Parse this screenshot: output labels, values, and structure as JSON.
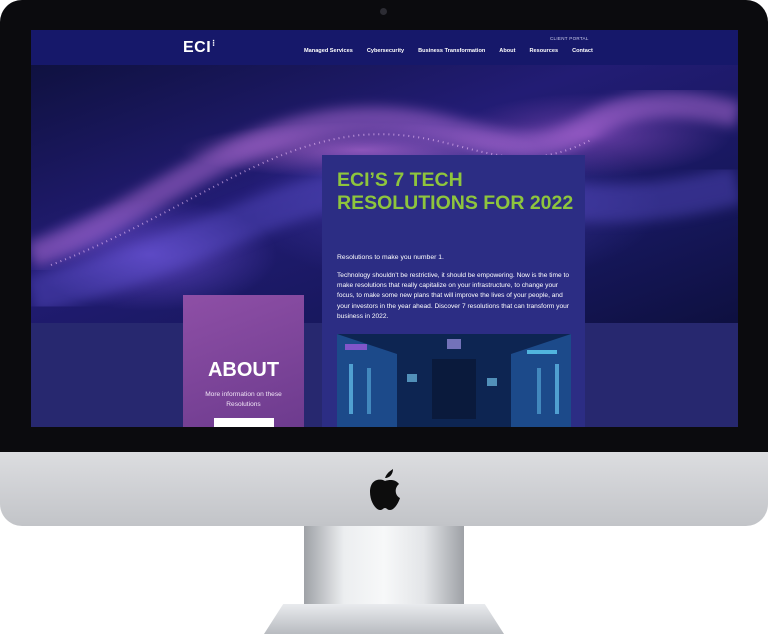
{
  "nav": {
    "logo": "ECI",
    "logo_mark": "⁝",
    "client_portal": "CLIENT PORTAL",
    "links": [
      "Managed Services",
      "Cybersecurity",
      "Business Transformation",
      "About",
      "Resources",
      "Contact"
    ]
  },
  "article": {
    "title": "ECI’S 7 TECH RESOLUTIONS FOR 2022",
    "subtitle": "Resolutions to make you number 1.",
    "body": "Technology shouldn’t be restrictive, it should be empowering. Now is the time to make resolutions that really capitalize on your infrastructure, to change your focus, to make some new plans that will improve the lives of your people, and your investors in the year ahead. Discover 7 resolutions that can transform your business in 2022."
  },
  "about": {
    "title": "ABOUT",
    "subtitle": "More information on these Resolutions"
  },
  "colors": {
    "brand_navy": "#16186a",
    "accent_green": "#8ec53d",
    "about_purple": "#8e4fa6"
  },
  "icons": {
    "hardware_logo": "apple-logo-icon"
  }
}
